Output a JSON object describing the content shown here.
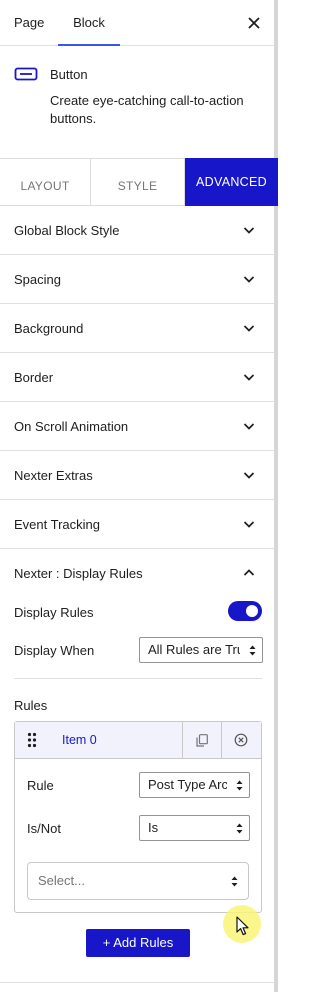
{
  "top_tabs": {
    "page": "Page",
    "block": "Block"
  },
  "block_card": {
    "icon": "button-block-icon",
    "name": "Button",
    "description": "Create eye-catching call-to-action buttons."
  },
  "style_tabs": {
    "layout": "LAYOUT",
    "style": "STYLE",
    "advanced": "ADVANCED",
    "active": "ADVANCED"
  },
  "panels": [
    {
      "title": "Global Block Style"
    },
    {
      "title": "Spacing"
    },
    {
      "title": "Background"
    },
    {
      "title": "Border"
    },
    {
      "title": "On Scroll Animation"
    },
    {
      "title": "Nexter Extras"
    },
    {
      "title": "Event Tracking"
    }
  ],
  "display_rules": {
    "title": "Nexter : Display Rules",
    "expanded": true,
    "toggle_label": "Display Rules",
    "toggle_on": true,
    "when_label": "Display When",
    "when_value": "All Rules are True",
    "rules_label": "Rules",
    "item": {
      "label": "Item 0",
      "rule_label": "Rule",
      "rule_value": "Post Type Archive",
      "isnot_label": "Is/Not",
      "isnot_value": "Is",
      "select_placeholder": "Select..."
    },
    "add_button": "+ Add Rules"
  },
  "colors": {
    "accent": "#1717c9",
    "tab_underline": "#3858e9",
    "item_header_bg": "#f2f2fc"
  }
}
